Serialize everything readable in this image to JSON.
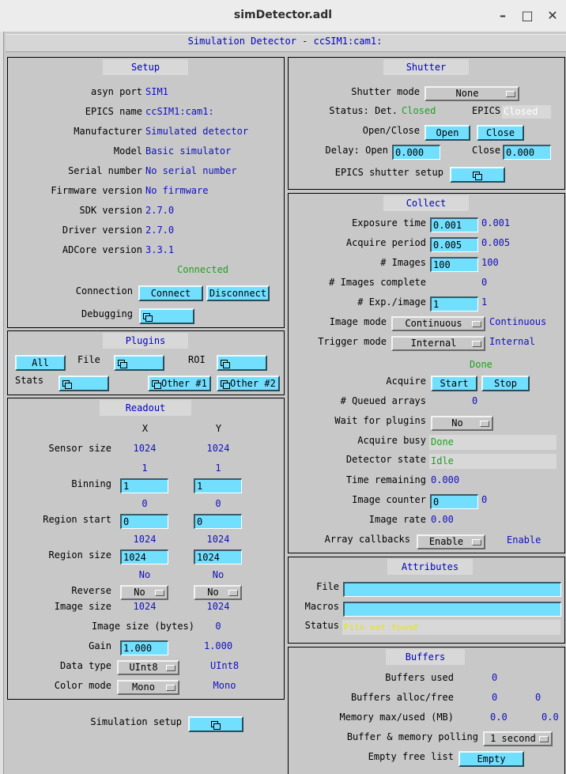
{
  "window": {
    "title": "simDetector.adl"
  },
  "banner": "Simulation Detector - ccSIM1:cam1:",
  "setup": {
    "title": "Setup",
    "rows": [
      {
        "label": "asyn port",
        "value": "SIM1"
      },
      {
        "label": "EPICS name",
        "value": "ccSIM1:cam1:"
      },
      {
        "label": "Manufacturer",
        "value": "Simulated detector"
      },
      {
        "label": "Model",
        "value": "Basic simulator"
      },
      {
        "label": "Serial number",
        "value": "No serial number"
      },
      {
        "label": "Firmware version",
        "value": "No firmware"
      },
      {
        "label": "SDK version",
        "value": "2.7.0"
      },
      {
        "label": "Driver version",
        "value": "2.7.0"
      },
      {
        "label": "ADCore version",
        "value": "3.3.1"
      }
    ],
    "connection_status": "Connected",
    "connection_label": "Connection",
    "connect_btn": "Connect",
    "disconnect_btn": "Disconnect",
    "debugging_label": "Debugging"
  },
  "plugins": {
    "title": "Plugins",
    "all_btn": "All",
    "file_label": "File",
    "roi_label": "ROI",
    "stats_label": "Stats",
    "other1_btn": "Other #1",
    "other2_btn": "Other #2"
  },
  "readout": {
    "title": "Readout",
    "col_x": "X",
    "col_y": "Y",
    "sensor_size_label": "Sensor size",
    "sensor_x": "1024",
    "sensor_y": "1024",
    "binning_label": "Binning",
    "binning_rb_x": "1",
    "binning_rb_y": "1",
    "binning_x": "1",
    "binning_y": "1",
    "region_start_label": "Region start",
    "region_start_rb_x": "0",
    "region_start_rb_y": "0",
    "region_start_x": "0",
    "region_start_y": "0",
    "region_size_label": "Region size",
    "region_size_rb_x": "1024",
    "region_size_rb_y": "1024",
    "region_size_x": "1024",
    "region_size_y": "1024",
    "reverse_label": "Reverse",
    "reverse_rb_x": "No",
    "reverse_rb_y": "No",
    "reverse_x": "No",
    "reverse_y": "No",
    "image_size_label": "Image size",
    "image_size_x": "1024",
    "image_size_y": "1024",
    "image_bytes_label": "Image size (bytes)",
    "image_bytes": "0",
    "gain_label": "Gain",
    "gain": "1.000",
    "gain_rb": "1.000",
    "data_type_label": "Data type",
    "data_type": "UInt8",
    "data_type_rb": "UInt8",
    "color_mode_label": "Color mode",
    "color_mode": "Mono",
    "color_mode_rb": "Mono"
  },
  "simulation_setup_label": "Simulation setup",
  "shutter": {
    "title": "Shutter",
    "mode_label": "Shutter mode",
    "mode": "None",
    "status_label": "Status: Det.",
    "det_status": "Closed",
    "epics_label": "EPICS",
    "epics_status": "Closed",
    "open_close_label": "Open/Close",
    "open_btn": "Open",
    "close_btn": "Close",
    "delay_open_label": "Delay: Open",
    "delay_open": "0.000",
    "delay_close_label": "Close",
    "delay_close": "0.000",
    "epics_setup_label": "EPICS shutter setup"
  },
  "collect": {
    "title": "Collect",
    "exposure_label": "Exposure time",
    "exposure": "0.001",
    "exposure_rb": "0.001",
    "period_label": "Acquire period",
    "period": "0.005",
    "period_rb": "0.005",
    "images_label": "# Images",
    "images": "100",
    "images_rb": "100",
    "images_complete_label": "# Images complete",
    "images_complete": "0",
    "exp_per_image_label": "# Exp./image",
    "exp_per_image": "1",
    "exp_per_image_rb": "1",
    "image_mode_label": "Image mode",
    "image_mode": "Continuous",
    "image_mode_rb": "Continuous",
    "trigger_mode_label": "Trigger mode",
    "trigger_mode": "Internal",
    "trigger_mode_rb": "Internal",
    "acquire_status": "Done",
    "acquire_label": "Acquire",
    "start_btn": "Start",
    "stop_btn": "Stop",
    "queued_label": "# Queued arrays",
    "queued": "0",
    "wait_label": "Wait for plugins",
    "wait": "No",
    "busy_label": "Acquire busy",
    "busy": "Done",
    "state_label": "Detector state",
    "state": "Idle",
    "time_remaining_label": "Time remaining",
    "time_remaining": "0.000",
    "counter_label": "Image counter",
    "counter": "0",
    "counter_rb": "0",
    "rate_label": "Image rate",
    "rate": "0.00",
    "callbacks_label": "Array callbacks",
    "callbacks": "Enable",
    "callbacks_rb": "Enable"
  },
  "attributes": {
    "title": "Attributes",
    "file_label": "File",
    "file": "",
    "macros_label": "Macros",
    "macros": "",
    "status_label": "Status",
    "status": "File not found"
  },
  "buffers": {
    "title": "Buffers",
    "used_label": "Buffers used",
    "used": "0",
    "alloc_label": "Buffers alloc/free",
    "alloc": "0",
    "free": "0",
    "memory_label": "Memory max/used (MB)",
    "mem_max": "0.0",
    "mem_used": "0.0",
    "polling_label": "Buffer & memory polling",
    "polling": "1 second",
    "empty_label": "Empty free list",
    "empty_btn": "Empty"
  },
  "colors": {
    "entry": "#73dfff",
    "readback": "#1010c0",
    "alarm_ok": "#1fa01f",
    "background": "#c8c8c8"
  }
}
